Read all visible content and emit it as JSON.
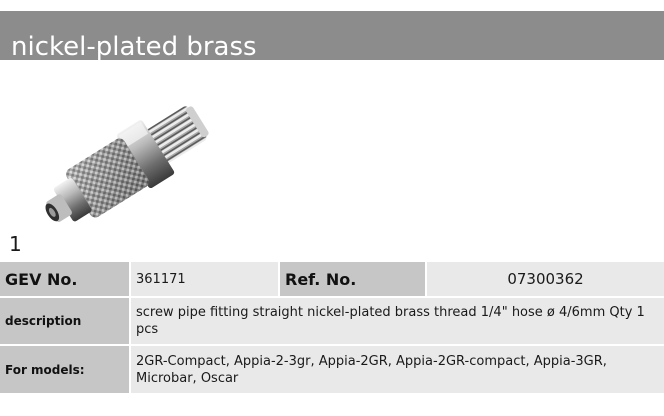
{
  "header": {
    "title": "nickel-plated brass"
  },
  "image": {
    "number": "1",
    "icon": "screw-pipe-fitting-photo"
  },
  "table": {
    "gev_label": "GEV No.",
    "gev_value": "361171",
    "ref_label": "Ref. No.",
    "ref_value": "07300362",
    "description_label": "description",
    "description_value": "screw pipe fitting  straight nickel-plated brass thread 1/4\" hose ø 4/6mm Qty 1 pcs",
    "models_label": "For models:",
    "models_value": "2GR-Compact, Appia-2-3gr, Appia-2GR, Appia-2GR-compact, Appia-3GR, Microbar, Oscar"
  },
  "colors": {
    "header_bg": "#8c8c8c",
    "label_bg": "#c6c6c6",
    "value_bg": "#e9e9e9"
  }
}
